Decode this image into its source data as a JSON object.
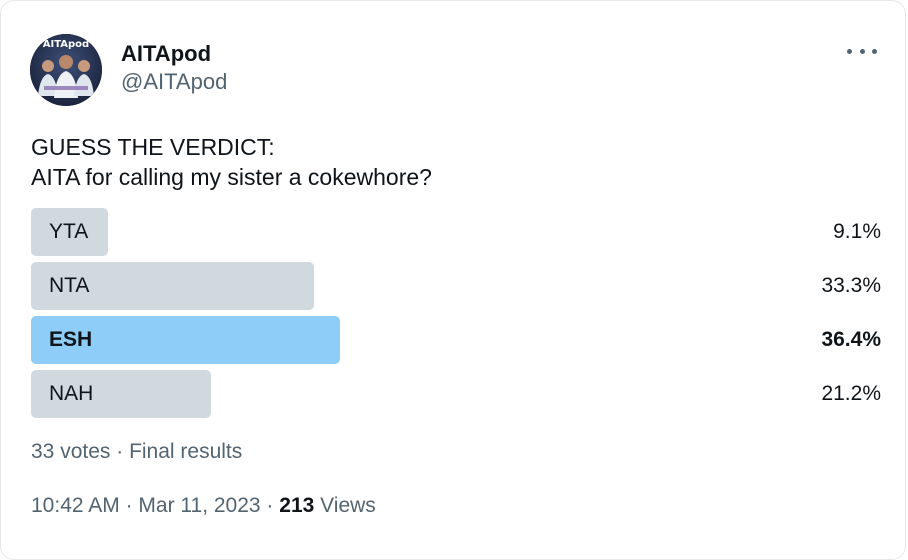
{
  "author": {
    "display_name": "AITApod",
    "handle": "@AITApod",
    "avatar_text": "AITApod"
  },
  "tweet": {
    "line1": "GUESS THE VERDICT:",
    "line2": "AITA for calling my sister a cokewhore?"
  },
  "poll": {
    "options": [
      {
        "label": "YTA",
        "percent_text": "9.1%",
        "percent": 9.1,
        "winner": false
      },
      {
        "label": "NTA",
        "percent_text": "33.3%",
        "percent": 33.3,
        "winner": false
      },
      {
        "label": "ESH",
        "percent_text": "36.4%",
        "percent": 36.4,
        "winner": true
      },
      {
        "label": "NAH",
        "percent_text": "21.2%",
        "percent": 21.2,
        "winner": false
      }
    ],
    "votes_text": "33 votes",
    "separator": " · ",
    "status_text": "Final results"
  },
  "meta": {
    "time": "10:42 AM",
    "separator": " · ",
    "date": "Mar 11, 2023",
    "views_count": "213",
    "views_label": " Views"
  },
  "colors": {
    "winner_bar": "#8ecdf8",
    "bar": "#cfd9de",
    "secondary_text": "#536471"
  },
  "icons": {
    "more": "more-horizontal-icon"
  }
}
